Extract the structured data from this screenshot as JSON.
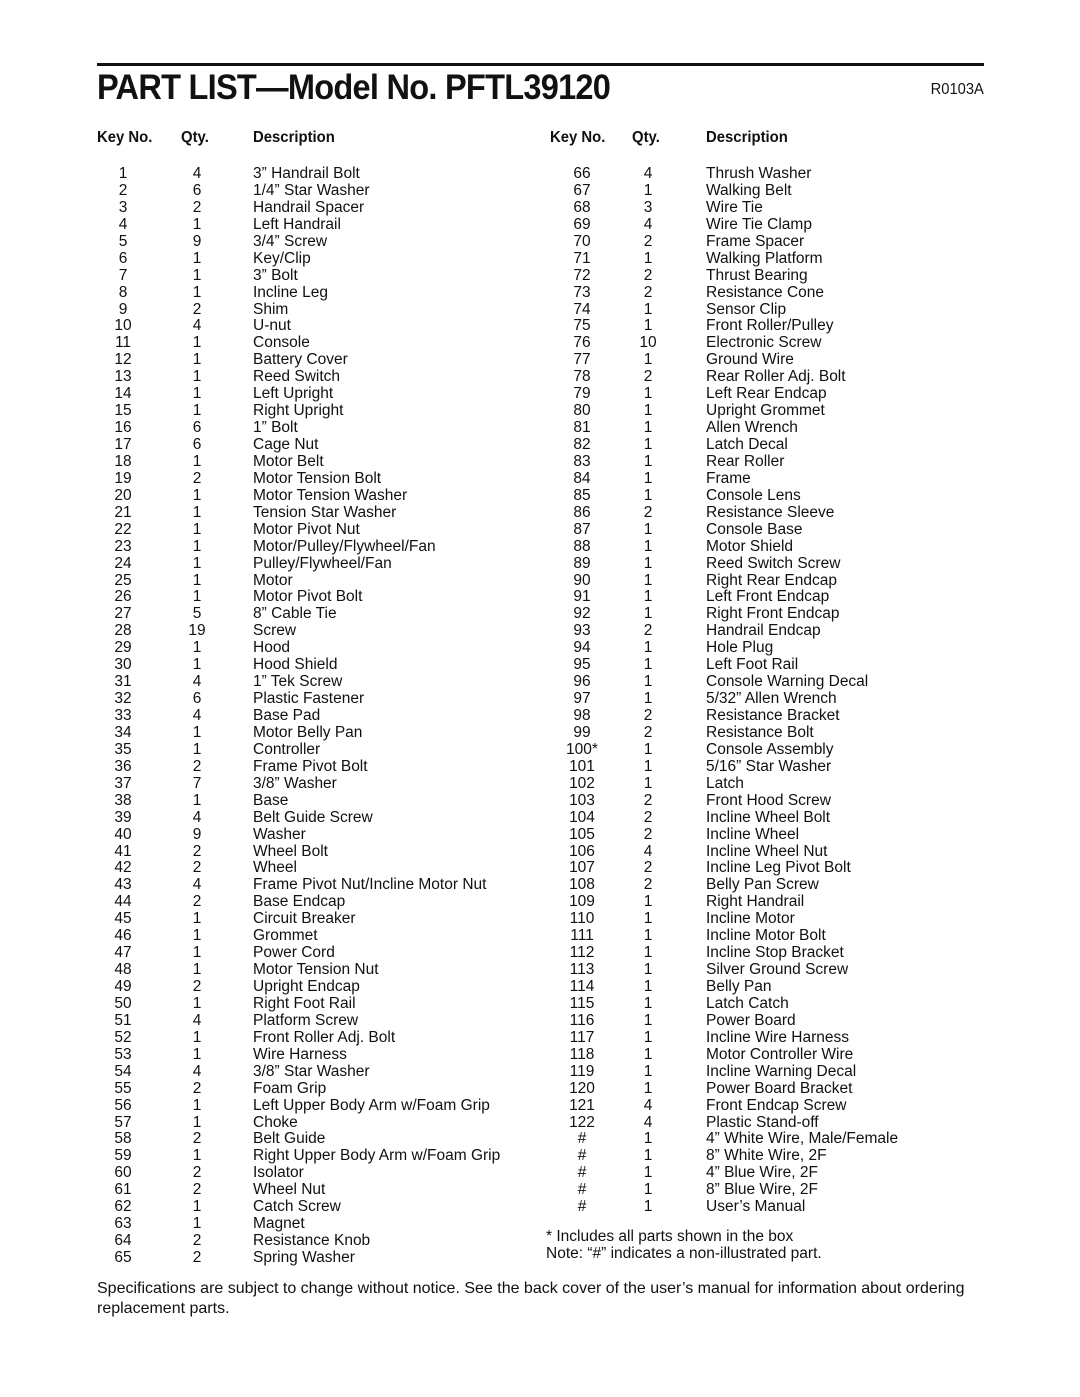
{
  "header": {
    "title": "PART LIST—Model No. PFTL39120",
    "doc_code": "R0103A"
  },
  "columns": {
    "key_label": "Key No.",
    "qty_label": "Qty.",
    "desc_label": "Description"
  },
  "parts_left": [
    {
      "key": "1",
      "qty": "4",
      "desc": "3” Handrail Bolt"
    },
    {
      "key": "2",
      "qty": "6",
      "desc": "1/4” Star Washer"
    },
    {
      "key": "3",
      "qty": "2",
      "desc": "Handrail Spacer"
    },
    {
      "key": "4",
      "qty": "1",
      "desc": "Left Handrail"
    },
    {
      "key": "5",
      "qty": "9",
      "desc": "3/4” Screw"
    },
    {
      "key": "6",
      "qty": "1",
      "desc": "Key/Clip"
    },
    {
      "key": "7",
      "qty": "1",
      "desc": "3” Bolt"
    },
    {
      "key": "8",
      "qty": "1",
      "desc": "Incline Leg"
    },
    {
      "key": "9",
      "qty": "2",
      "desc": "Shim"
    },
    {
      "key": "10",
      "qty": "4",
      "desc": "U-nut"
    },
    {
      "key": "11",
      "qty": "1",
      "desc": "Console"
    },
    {
      "key": "12",
      "qty": "1",
      "desc": "Battery Cover"
    },
    {
      "key": "13",
      "qty": "1",
      "desc": "Reed Switch"
    },
    {
      "key": "14",
      "qty": "1",
      "desc": "Left Upright"
    },
    {
      "key": "15",
      "qty": "1",
      "desc": "Right Upright"
    },
    {
      "key": "16",
      "qty": "6",
      "desc": "1” Bolt"
    },
    {
      "key": "17",
      "qty": "6",
      "desc": "Cage Nut"
    },
    {
      "key": "18",
      "qty": "1",
      "desc": "Motor Belt"
    },
    {
      "key": "19",
      "qty": "2",
      "desc": "Motor Tension Bolt"
    },
    {
      "key": "20",
      "qty": "1",
      "desc": "Motor Tension Washer"
    },
    {
      "key": "21",
      "qty": "1",
      "desc": "Tension Star Washer"
    },
    {
      "key": "22",
      "qty": "1",
      "desc": "Motor Pivot Nut"
    },
    {
      "key": "23",
      "qty": "1",
      "desc": "Motor/Pulley/Flywheel/Fan"
    },
    {
      "key": "24",
      "qty": "1",
      "desc": "Pulley/Flywheel/Fan"
    },
    {
      "key": "25",
      "qty": "1",
      "desc": "Motor"
    },
    {
      "key": "26",
      "qty": "1",
      "desc": "Motor Pivot Bolt"
    },
    {
      "key": "27",
      "qty": "5",
      "desc": "8” Cable Tie"
    },
    {
      "key": "28",
      "qty": "19",
      "desc": "Screw"
    },
    {
      "key": "29",
      "qty": "1",
      "desc": "Hood"
    },
    {
      "key": "30",
      "qty": "1",
      "desc": "Hood Shield"
    },
    {
      "key": "31",
      "qty": "4",
      "desc": "1” Tek Screw"
    },
    {
      "key": "32",
      "qty": "6",
      "desc": "Plastic Fastener"
    },
    {
      "key": "33",
      "qty": "4",
      "desc": "Base Pad"
    },
    {
      "key": "34",
      "qty": "1",
      "desc": "Motor Belly Pan"
    },
    {
      "key": "35",
      "qty": "1",
      "desc": "Controller"
    },
    {
      "key": "36",
      "qty": "2",
      "desc": "Frame Pivot Bolt"
    },
    {
      "key": "37",
      "qty": "7",
      "desc": "3/8” Washer"
    },
    {
      "key": "38",
      "qty": "1",
      "desc": "Base"
    },
    {
      "key": "39",
      "qty": "4",
      "desc": "Belt Guide Screw"
    },
    {
      "key": "40",
      "qty": "9",
      "desc": "Washer"
    },
    {
      "key": "41",
      "qty": "2",
      "desc": "Wheel Bolt"
    },
    {
      "key": "42",
      "qty": "2",
      "desc": "Wheel"
    },
    {
      "key": "43",
      "qty": "4",
      "desc": "Frame Pivot Nut/Incline Motor Nut"
    },
    {
      "key": "44",
      "qty": "2",
      "desc": "Base Endcap"
    },
    {
      "key": "45",
      "qty": "1",
      "desc": "Circuit Breaker"
    },
    {
      "key": "46",
      "qty": "1",
      "desc": "Grommet"
    },
    {
      "key": "47",
      "qty": "1",
      "desc": "Power Cord"
    },
    {
      "key": "48",
      "qty": "1",
      "desc": "Motor Tension Nut"
    },
    {
      "key": "49",
      "qty": "2",
      "desc": "Upright Endcap"
    },
    {
      "key": "50",
      "qty": "1",
      "desc": "Right Foot Rail"
    },
    {
      "key": "51",
      "qty": "4",
      "desc": "Platform Screw"
    },
    {
      "key": "52",
      "qty": "1",
      "desc": "Front Roller Adj. Bolt"
    },
    {
      "key": "53",
      "qty": "1",
      "desc": "Wire Harness"
    },
    {
      "key": "54",
      "qty": "4",
      "desc": "3/8” Star Washer"
    },
    {
      "key": "55",
      "qty": "2",
      "desc": "Foam Grip"
    },
    {
      "key": "56",
      "qty": "1",
      "desc": "Left Upper Body Arm w/Foam Grip"
    },
    {
      "key": "57",
      "qty": "1",
      "desc": "Choke"
    },
    {
      "key": "58",
      "qty": "2",
      "desc": "Belt Guide"
    },
    {
      "key": "59",
      "qty": "1",
      "desc": "Right Upper Body Arm w/Foam Grip"
    },
    {
      "key": "60",
      "qty": "2",
      "desc": "Isolator"
    },
    {
      "key": "61",
      "qty": "2",
      "desc": "Wheel Nut"
    },
    {
      "key": "62",
      "qty": "1",
      "desc": "Catch Screw"
    },
    {
      "key": "63",
      "qty": "1",
      "desc": "Magnet"
    },
    {
      "key": "64",
      "qty": "2",
      "desc": "Resistance Knob"
    },
    {
      "key": "65",
      "qty": "2",
      "desc": "Spring Washer"
    }
  ],
  "parts_right": [
    {
      "key": "66",
      "qty": "4",
      "desc": "Thrush Washer"
    },
    {
      "key": "67",
      "qty": "1",
      "desc": "Walking Belt"
    },
    {
      "key": "68",
      "qty": "3",
      "desc": "Wire Tie"
    },
    {
      "key": "69",
      "qty": "4",
      "desc": "Wire Tie Clamp"
    },
    {
      "key": "70",
      "qty": "2",
      "desc": "Frame Spacer"
    },
    {
      "key": "71",
      "qty": "1",
      "desc": "Walking Platform"
    },
    {
      "key": "72",
      "qty": "2",
      "desc": "Thrust Bearing"
    },
    {
      "key": "73",
      "qty": "2",
      "desc": "Resistance Cone"
    },
    {
      "key": "74",
      "qty": "1",
      "desc": "Sensor Clip"
    },
    {
      "key": "75",
      "qty": "1",
      "desc": "Front Roller/Pulley"
    },
    {
      "key": "76",
      "qty": "10",
      "desc": "Electronic Screw"
    },
    {
      "key": "77",
      "qty": "1",
      "desc": "Ground Wire"
    },
    {
      "key": "78",
      "qty": "2",
      "desc": "Rear Roller Adj. Bolt"
    },
    {
      "key": "79",
      "qty": "1",
      "desc": "Left Rear Endcap"
    },
    {
      "key": "80",
      "qty": "1",
      "desc": "Upright Grommet"
    },
    {
      "key": "81",
      "qty": "1",
      "desc": "Allen Wrench"
    },
    {
      "key": "82",
      "qty": "1",
      "desc": "Latch Decal"
    },
    {
      "key": "83",
      "qty": "1",
      "desc": "Rear Roller"
    },
    {
      "key": "84",
      "qty": "1",
      "desc": "Frame"
    },
    {
      "key": "85",
      "qty": "1",
      "desc": "Console Lens"
    },
    {
      "key": "86",
      "qty": "2",
      "desc": "Resistance Sleeve"
    },
    {
      "key": "87",
      "qty": "1",
      "desc": "Console Base"
    },
    {
      "key": "88",
      "qty": "1",
      "desc": "Motor Shield"
    },
    {
      "key": "89",
      "qty": "1",
      "desc": "Reed Switch Screw"
    },
    {
      "key": "90",
      "qty": "1",
      "desc": "Right Rear Endcap"
    },
    {
      "key": "91",
      "qty": "1",
      "desc": "Left Front Endcap"
    },
    {
      "key": "92",
      "qty": "1",
      "desc": "Right Front Endcap"
    },
    {
      "key": "93",
      "qty": "2",
      "desc": "Handrail Endcap"
    },
    {
      "key": "94",
      "qty": "1",
      "desc": "Hole Plug"
    },
    {
      "key": "95",
      "qty": "1",
      "desc": "Left Foot Rail"
    },
    {
      "key": "96",
      "qty": "1",
      "desc": "Console Warning Decal"
    },
    {
      "key": "97",
      "qty": "1",
      "desc": "5/32” Allen Wrench"
    },
    {
      "key": "98",
      "qty": "2",
      "desc": "Resistance Bracket"
    },
    {
      "key": "99",
      "qty": "2",
      "desc": "Resistance Bolt"
    },
    {
      "key": "100*",
      "qty": "1",
      "desc": "Console Assembly"
    },
    {
      "key": "101",
      "qty": "1",
      "desc": "5/16” Star Washer"
    },
    {
      "key": "102",
      "qty": "1",
      "desc": "Latch"
    },
    {
      "key": "103",
      "qty": "2",
      "desc": "Front Hood Screw"
    },
    {
      "key": "104",
      "qty": "2",
      "desc": "Incline Wheel Bolt"
    },
    {
      "key": "105",
      "qty": "2",
      "desc": "Incline Wheel"
    },
    {
      "key": "106",
      "qty": "4",
      "desc": "Incline Wheel Nut"
    },
    {
      "key": "107",
      "qty": "2",
      "desc": "Incline Leg Pivot Bolt"
    },
    {
      "key": "108",
      "qty": "2",
      "desc": "Belly Pan Screw"
    },
    {
      "key": "109",
      "qty": "1",
      "desc": "Right Handrail"
    },
    {
      "key": "110",
      "qty": "1",
      "desc": "Incline Motor"
    },
    {
      "key": "111",
      "qty": "1",
      "desc": "Incline Motor Bolt"
    },
    {
      "key": "112",
      "qty": "1",
      "desc": "Incline Stop Bracket"
    },
    {
      "key": "113",
      "qty": "1",
      "desc": "Silver Ground Screw"
    },
    {
      "key": "114",
      "qty": "1",
      "desc": "Belly Pan"
    },
    {
      "key": "115",
      "qty": "1",
      "desc": "Latch Catch"
    },
    {
      "key": "116",
      "qty": "1",
      "desc": "Power Board"
    },
    {
      "key": "117",
      "qty": "1",
      "desc": "Incline Wire Harness"
    },
    {
      "key": "118",
      "qty": "1",
      "desc": "Motor Controller Wire"
    },
    {
      "key": "119",
      "qty": "1",
      "desc": "Incline Warning Decal"
    },
    {
      "key": "120",
      "qty": "1",
      "desc": "Power Board Bracket"
    },
    {
      "key": "121",
      "qty": "4",
      "desc": "Front Endcap Screw"
    },
    {
      "key": "122",
      "qty": "4",
      "desc": "Plastic Stand-off"
    },
    {
      "key": "#",
      "qty": "1",
      "desc": "4” White Wire, Male/Female"
    },
    {
      "key": "#",
      "qty": "1",
      "desc": "8” White Wire, 2F"
    },
    {
      "key": "#",
      "qty": "1",
      "desc": "4” Blue Wire, 2F"
    },
    {
      "key": "#",
      "qty": "1",
      "desc": "8” Blue Wire, 2F"
    },
    {
      "key": "#",
      "qty": "1",
      "desc": "User’s Manual"
    }
  ],
  "notes": {
    "asterisk_note": "* Includes all parts shown in the box",
    "hash_note": "Note: “#” indicates a non-illustrated part."
  },
  "footer": {
    "text": "Specifications are subject to change without notice. See the back cover of the user’s manual for information about ordering replacement parts."
  }
}
